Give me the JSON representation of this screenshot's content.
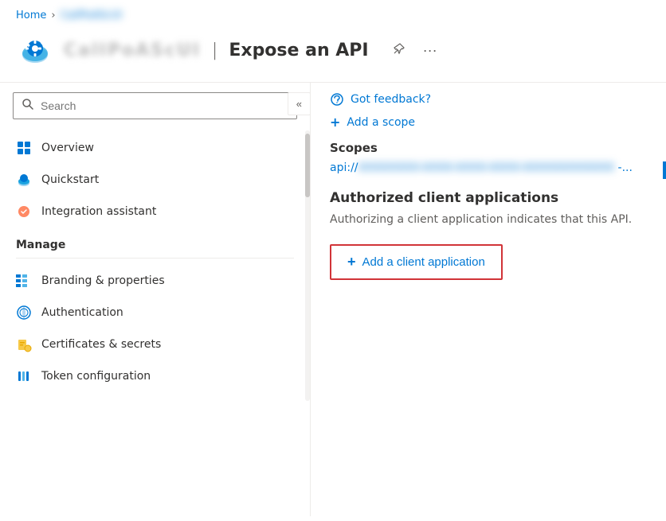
{
  "breadcrumb": {
    "home_label": "Home",
    "separator": ">",
    "app_label": "CalIPoAScUI"
  },
  "header": {
    "app_name": "CalIPoAScUI",
    "title_divider": "|",
    "page_title": "Expose an API",
    "pin_icon": "📌",
    "more_icon": "···"
  },
  "sidebar": {
    "search_placeholder": "Search",
    "collapse_icon": "«",
    "nav_items": [
      {
        "id": "overview",
        "label": "Overview"
      },
      {
        "id": "quickstart",
        "label": "Quickstart"
      },
      {
        "id": "integration",
        "label": "Integration assistant"
      }
    ],
    "manage_label": "Manage",
    "manage_items": [
      {
        "id": "branding",
        "label": "Branding & properties"
      },
      {
        "id": "authentication",
        "label": "Authentication"
      },
      {
        "id": "certificates",
        "label": "Certificates & secrets"
      },
      {
        "id": "token-config",
        "label": "Token configuration"
      }
    ]
  },
  "content": {
    "feedback_label": "Got feedback?",
    "add_scope_label": "Add a scope",
    "scopes_header": "Scopes",
    "scope_link_prefix": "api://",
    "scope_link_blurred": "XXXXXXXX-XXXX-XXXX-XXXX-XXXXXXXXXXXX",
    "scope_link_suffix": " -...",
    "auth_clients_header": "Authorized client applications",
    "auth_clients_desc": "Authorizing a client application indicates that this API.",
    "add_client_label": "Add a client application"
  }
}
